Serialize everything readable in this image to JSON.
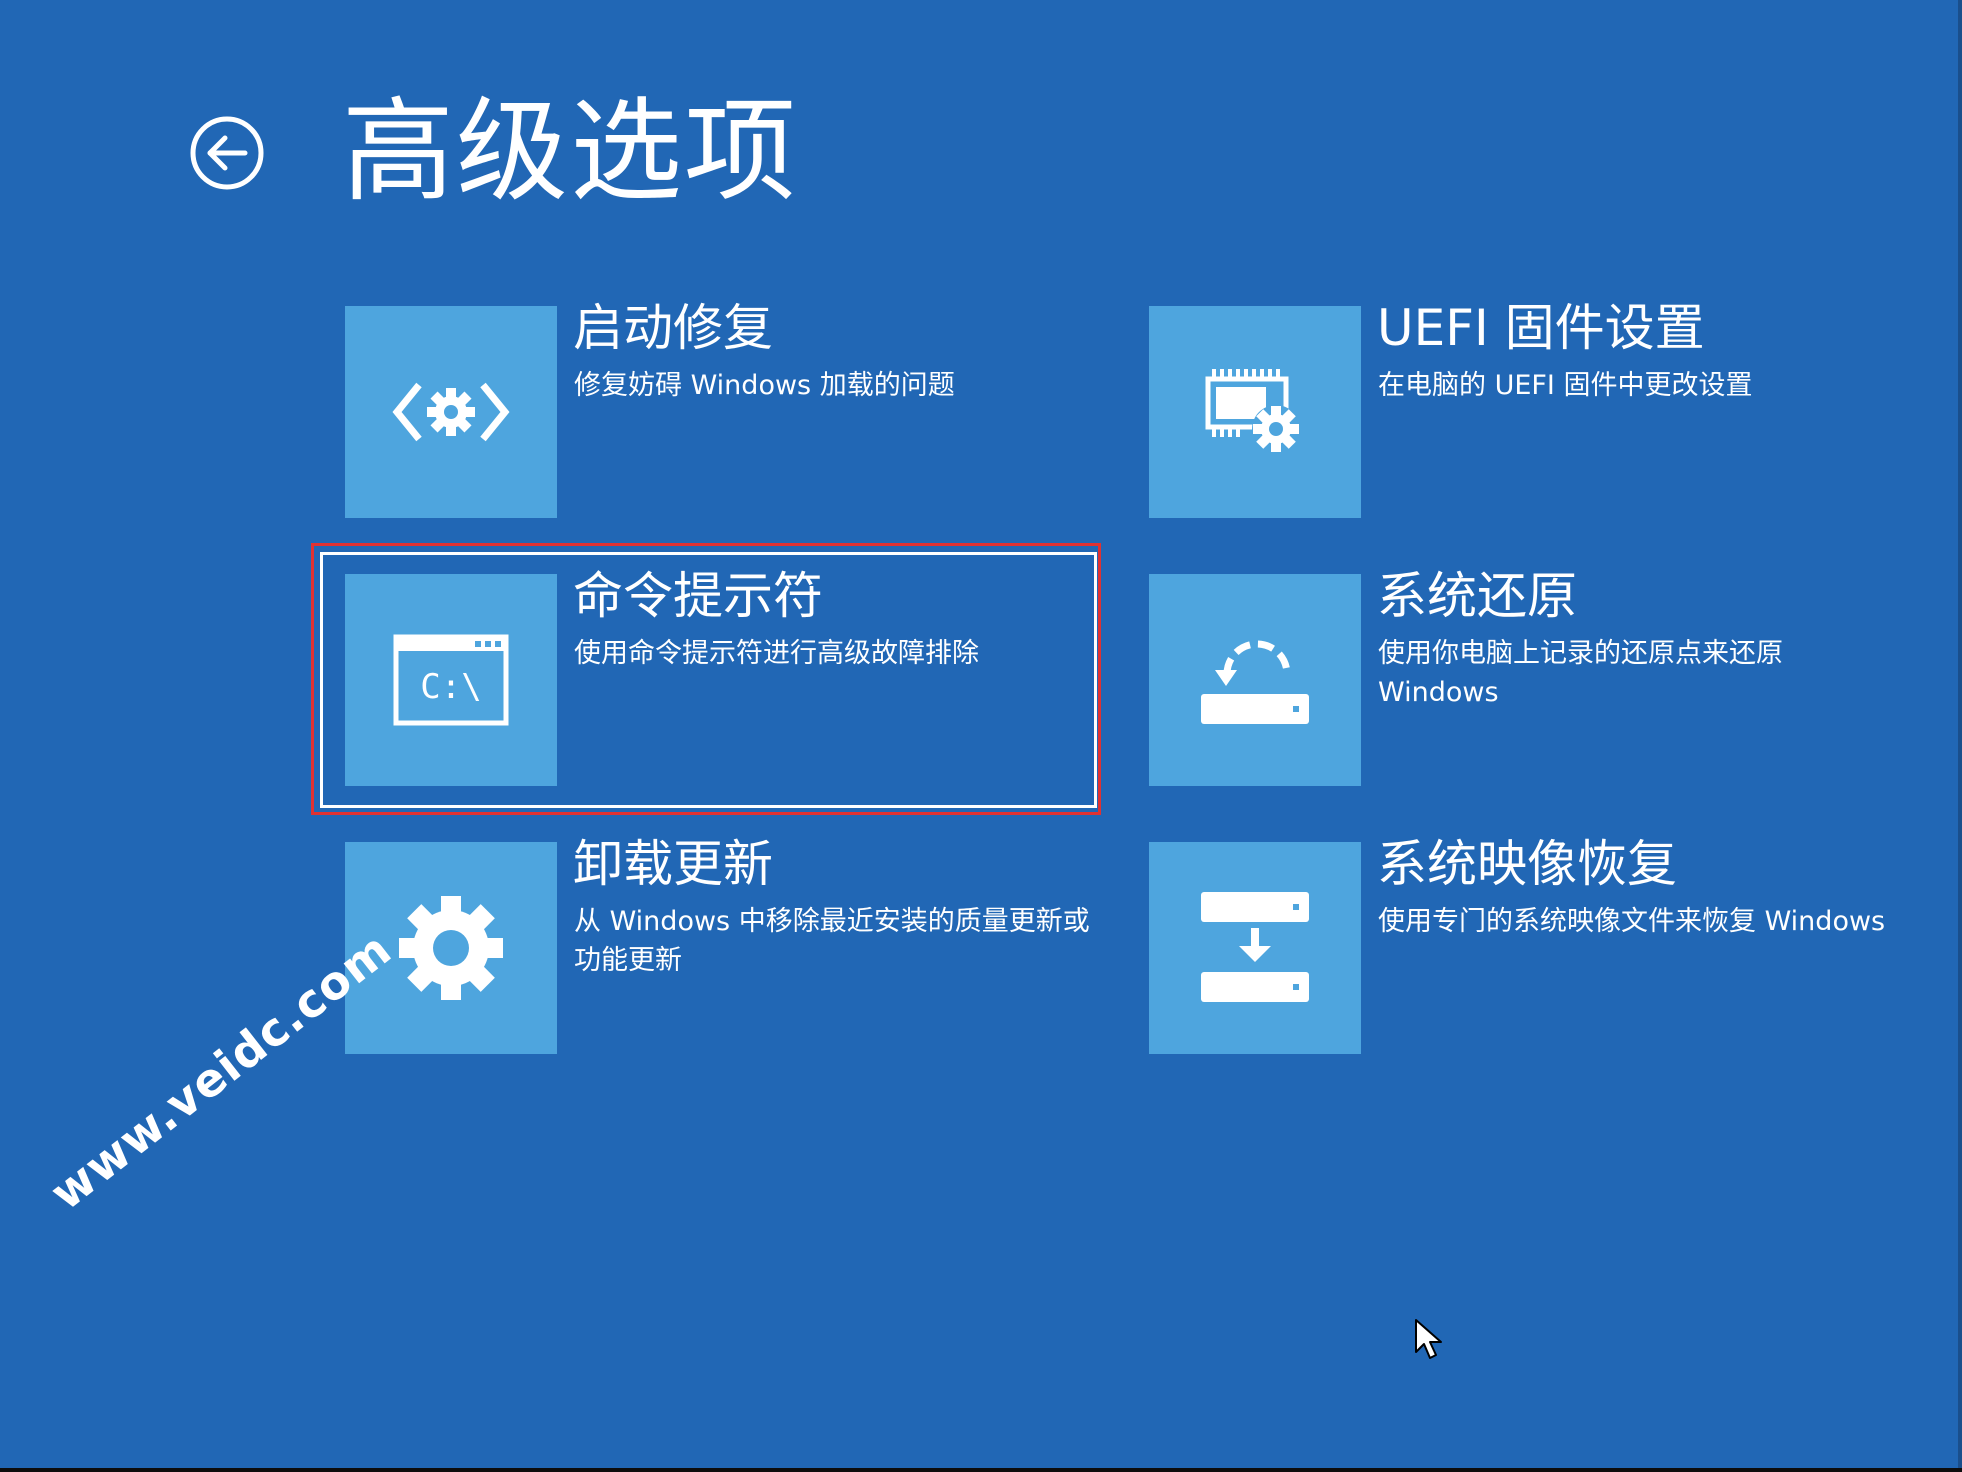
{
  "page": {
    "title": "高级选项",
    "background_color": "#2167b5",
    "tile_color": "#4ea5de"
  },
  "back_button": {
    "icon": "back-arrow-circle-icon"
  },
  "options": [
    {
      "title": "启动修复",
      "description": "修复妨碍 Windows 加载的问题",
      "icon": "startup-repair-icon"
    },
    {
      "title": "UEFI 固件设置",
      "description": "在电脑的 UEFI 固件中更改设置",
      "icon": "uefi-chip-gear-icon"
    },
    {
      "title": "命令提示符",
      "description": "使用命令提示符进行高级故障排除",
      "icon": "command-prompt-icon",
      "icon_text": "C:\\",
      "highlighted": true,
      "highlight_color": "#e03232"
    },
    {
      "title": "系统还原",
      "description": "使用你电脑上记录的还原点来还原 Windows",
      "icon": "system-restore-icon"
    },
    {
      "title": "卸载更新",
      "description": "从 Windows 中移除最近安装的质量更新或功能更新",
      "icon": "gear-icon"
    },
    {
      "title": "系统映像恢复",
      "description": "使用专门的系统映像文件来恢复 Windows",
      "icon": "system-image-recovery-icon"
    }
  ],
  "watermark": {
    "text": "www.veidc.com"
  },
  "cursor": {
    "icon": "mouse-pointer-icon"
  }
}
